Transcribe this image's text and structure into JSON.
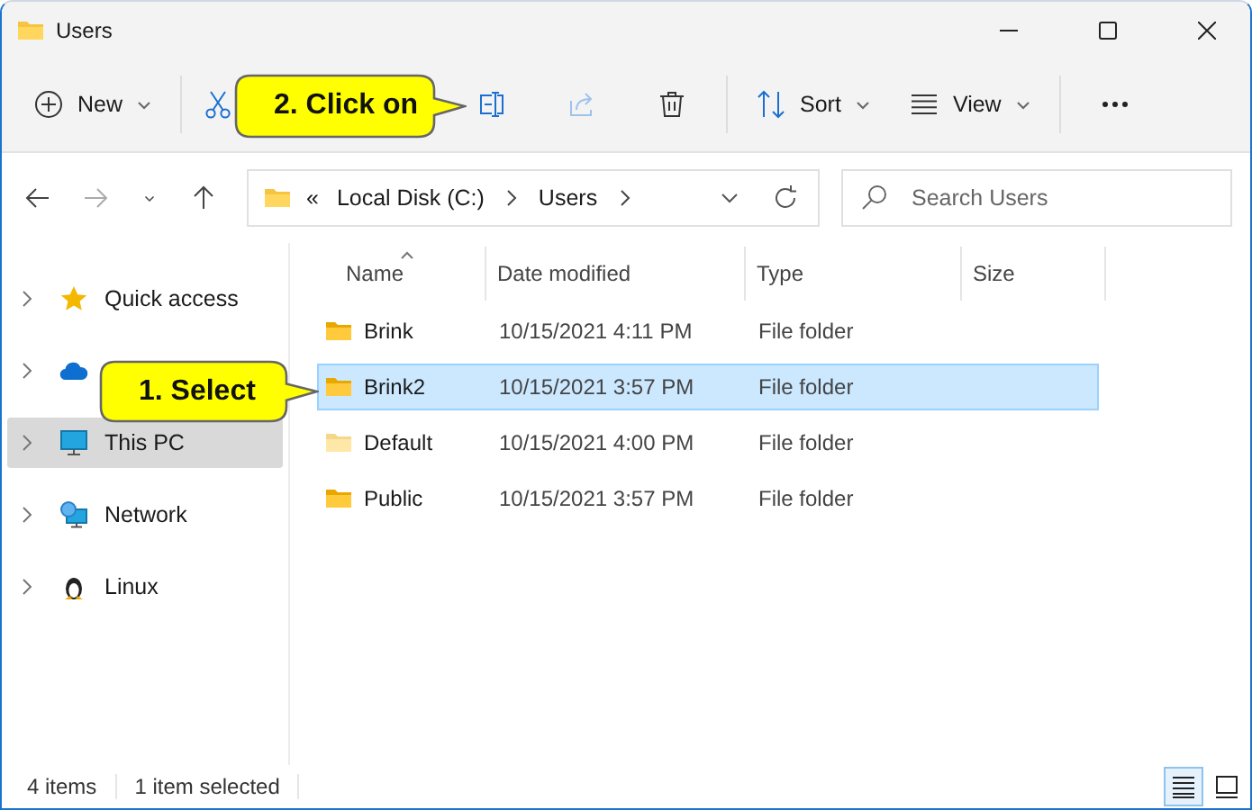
{
  "window": {
    "title": "Users"
  },
  "toolbar": [
    {
      "kind": "new",
      "label": "New",
      "dropdown": true,
      "disabled": false
    },
    {
      "kind": "cut",
      "dropdown": false,
      "disabled": false
    },
    {
      "kind": "rename",
      "dropdown": false,
      "disabled": false
    },
    {
      "kind": "share",
      "dropdown": false,
      "disabled": true
    },
    {
      "kind": "delete",
      "dropdown": false,
      "disabled": false
    },
    {
      "kind": "sort",
      "label": "Sort",
      "dropdown": true,
      "disabled": false
    },
    {
      "kind": "view",
      "label": "View",
      "dropdown": true,
      "disabled": false
    },
    {
      "kind": "more",
      "dropdown": false,
      "disabled": false
    }
  ],
  "navigation": [
    {
      "kind": "back",
      "disabled": false
    },
    {
      "kind": "forward",
      "disabled": true
    },
    {
      "kind": "recent",
      "disabled": false
    },
    {
      "kind": "up",
      "disabled": false
    }
  ],
  "address": {
    "overflow": "«",
    "path": [
      "Local Disk (C:)",
      "Users"
    ]
  },
  "search": {
    "placeholder": "Search Users"
  },
  "sidebar": {
    "items": [
      {
        "kind": "star",
        "label": "Quick access",
        "selected": false
      },
      {
        "kind": "cloud",
        "selected": false
      },
      {
        "kind": "pc",
        "label": "This PC",
        "selected": true
      },
      {
        "kind": "network",
        "label": "Network",
        "selected": false
      },
      {
        "kind": "penguin",
        "label": "Linux",
        "selected": false
      }
    ]
  },
  "table": {
    "columns": [
      {
        "label": "Name",
        "sorted": true
      },
      {
        "label": "Date modified",
        "sorted": false
      },
      {
        "label": "Type",
        "sorted": false
      },
      {
        "label": "Size",
        "sorted": false
      }
    ],
    "rows": [
      {
        "name": "Brink",
        "date": "10/15/2021 4:11 PM",
        "type": "File folder",
        "selected": false,
        "hidden": false
      },
      {
        "name": "Brink2",
        "date": "10/15/2021 3:57 PM",
        "type": "File folder",
        "selected": true,
        "hidden": false
      },
      {
        "name": "Default",
        "date": "10/15/2021 4:00 PM",
        "type": "File folder",
        "selected": false,
        "hidden": true
      },
      {
        "name": "Public",
        "date": "10/15/2021 3:57 PM",
        "type": "File folder",
        "selected": false,
        "hidden": false
      }
    ]
  },
  "status_bar": {
    "count": "4 items",
    "selection": "1 item selected",
    "views": [
      {
        "kind": "details",
        "selected": true
      },
      {
        "kind": "tiles",
        "selected": false
      }
    ]
  },
  "callouts": [
    {
      "text": "1. Select"
    },
    {
      "text": "2. Click on"
    }
  ]
}
